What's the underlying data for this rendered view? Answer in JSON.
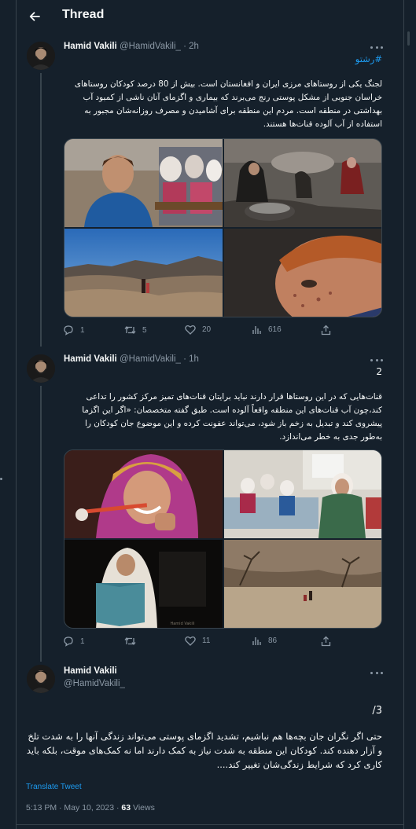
{
  "header": {
    "title": "Thread"
  },
  "tweets": [
    {
      "name": "Hamid Vakili",
      "handle": "@HamidVakili_",
      "time": "· 2h",
      "hashtag": "#رشتو",
      "text": "لجنگ یکی از روستاهای مرزی ایران و افغانستان است. بیش از 80 درصد کودکان روستاهای خراسان جنوبی از مشکل پوستی رنج می‌برند که بیماری و اگزمای آنان ناشی از کمبود آب بهداشتی در منطقه است. مردم این منطقه برای آشامیدن و مصرف روزانه‌شان مجبور به استفاده از آب آلوده قنات‌ها هستند.",
      "stats": {
        "replies": "1",
        "retweets": "5",
        "likes": "20",
        "views": "616"
      }
    },
    {
      "name": "Hamid Vakili",
      "handle": "@HamidVakili_",
      "time": "· 1h",
      "number": "2",
      "text": "قنات‌هایی که در این روستاها قرار دارند نباید برایتان قنات‌های تمیز مرکز کشور را تداعی کند،چون آب قنات‌های این منطقه واقعاً آلوده است. طبق گفته متخصصان: «اگر این اگزما پیشروی کند و تبدیل به زخم باز شود، می‌تواند عفونت کرده و این موضوع جان کودکان را به‌طور جدی به خطر می‌اندازد.",
      "stats": {
        "replies": "1",
        "retweets": "",
        "likes": "11",
        "views": "86"
      }
    },
    {
      "name": "Hamid Vakili",
      "handle": "@HamidVakili_",
      "number": "3/",
      "text": "حتی اگر نگران جان بچه‌ها هم نباشیم، تشدید اگزمای پوستی می‌تواند زندگی آنها را به شدت تلخ و آزار دهنده کند. کودکان این منطقه به شدت نیاز به کمک دارند اما نه کمک‌های موقت، بلکه باید کاری کرد که شرایط زندگی‌شان تغییر کند....",
      "translate": "Translate Tweet",
      "timestamp": "5:13 PM · May 10, 2023 · ",
      "views_count": "63",
      "views_label": " Views"
    }
  ],
  "image_watermark": "Hamid Vakili",
  "icons": [
    "back-arrow-icon",
    "more-icon",
    "reply-icon",
    "retweet-icon",
    "like-icon",
    "views-icon",
    "share-icon"
  ],
  "colors": {
    "background": "#15202b",
    "border": "#38444d",
    "text": "#f7f9f9",
    "muted": "#8b98a5",
    "accent": "#1d9bf0"
  }
}
